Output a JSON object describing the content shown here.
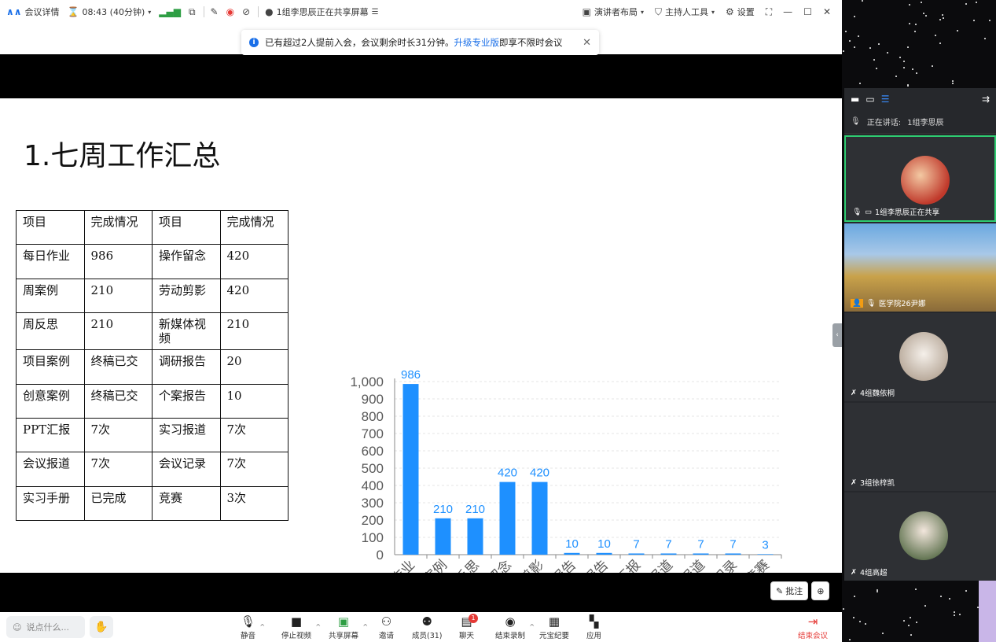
{
  "topbar": {
    "meeting_details": "会议详情",
    "timer": "08:43 (40分钟)",
    "sharing_status": "1组李思辰正在共享屏幕",
    "presenter_layout": "演讲者布局",
    "host_tools": "主持人工具",
    "settings": "设置"
  },
  "notice": {
    "text_before": "已有超过2人提前入会，会议剩余时长31分钟。",
    "link": "升级专业版",
    "text_after": "即享不限时会议"
  },
  "slide": {
    "title": "1.七周工作汇总",
    "table": {
      "headers": [
        "项目",
        "完成情况",
        "项目",
        "完成情况"
      ],
      "rows": [
        [
          "每日作业",
          "986",
          "操作留念",
          "420"
        ],
        [
          "周案例",
          "210",
          "劳动剪影",
          "420"
        ],
        [
          "周反思",
          "210",
          "新媒体视频",
          "210"
        ],
        [
          "项目案例",
          "终稿已交",
          "调研报告",
          "20"
        ],
        [
          "创意案例",
          "终稿已交",
          "个案报告",
          "10"
        ],
        [
          "PPT汇报",
          "7次",
          "实习报道",
          "7次"
        ],
        [
          "会议报道",
          "7次",
          "会议记录",
          "7次"
        ],
        [
          "实习手册",
          "已完成",
          "竞赛",
          "3次"
        ]
      ]
    }
  },
  "chart_data": {
    "type": "bar",
    "categories": [
      "每日作业",
      "周案例",
      "周反思",
      "操作留念",
      "劳动剪影",
      "调研报告",
      "个案报告",
      "PPT汇报",
      "实习报道",
      "会议报道",
      "会议记录",
      "竞赛"
    ],
    "values": [
      986,
      210,
      210,
      420,
      420,
      10,
      10,
      7,
      7,
      7,
      7,
      3
    ],
    "value_labels": [
      "986",
      "210",
      "210",
      "420",
      "420",
      "10",
      "10",
      "7",
      "7",
      "7",
      "7",
      "3"
    ],
    "y_ticks": [
      "0",
      "100",
      "200",
      "300",
      "400",
      "500",
      "600",
      "700",
      "800",
      "900",
      "1,000"
    ],
    "ylim": [
      0,
      1000
    ],
    "bar_color": "#1e90ff",
    "title": "",
    "xlabel": "",
    "ylabel": ""
  },
  "annotation": {
    "annotate_label": "批注"
  },
  "toolbar": {
    "say_placeholder": "说点什么...",
    "mute": "静音",
    "stop_video": "停止视频",
    "share_screen": "共享屏幕",
    "invite": "邀请",
    "members": "成员(31)",
    "chat": "聊天",
    "chat_badge": "1",
    "end_recording": "结束录制",
    "yuanbao": "元宝纪要",
    "apps": "应用",
    "end_meeting": "结束会议"
  },
  "panel": {
    "speaking_label": "正在讲话:",
    "speaking_name": "1组李思辰",
    "participants": [
      {
        "name": "1组李思辰正在共享"
      },
      {
        "name": "医学院26尹娜"
      },
      {
        "name": "4组魏依桐"
      },
      {
        "name": "3组徐梓凯"
      },
      {
        "name": "4组高超"
      }
    ]
  }
}
